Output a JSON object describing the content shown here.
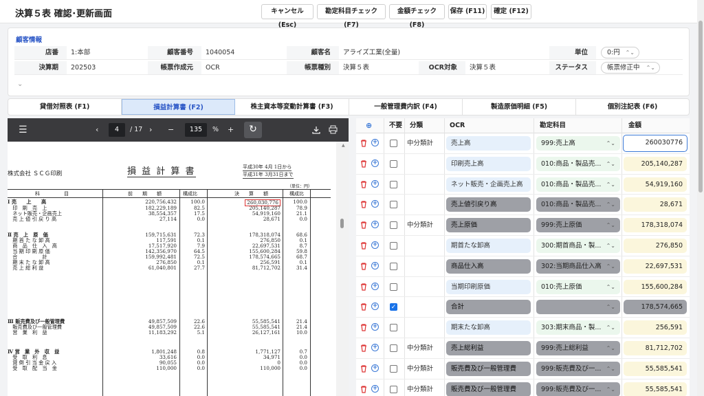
{
  "header": {
    "title": "決算５表 確認･更新画面",
    "buttons": [
      "キャンセル (Esc)",
      "勘定科目チェック (F7)",
      "金額チェック (F8)",
      "保存 (F11)",
      "確定 (F12)"
    ]
  },
  "customer": {
    "title": "顧客情報",
    "labels": {
      "store": "店番",
      "cust_no": "顧客番号",
      "cust_name": "顧客名",
      "unit": "単位",
      "period": "決算期",
      "created_by": "帳票作成元",
      "form_type": "帳票種別",
      "ocr_target": "OCR対象",
      "status": "ステータス"
    },
    "values": {
      "store": "1:本部",
      "cust_no": "1040054",
      "cust_name": "アライズ工業(全量)",
      "unit": "0:円",
      "period": "202503",
      "created_by": "OCR",
      "form_type": "決算５表",
      "ocr_target": "決算５表",
      "status": "帳票修正中"
    }
  },
  "tabs": [
    "貸借対照表 (F1)",
    "損益計算書 (F2)",
    "株主資本等変動計算書 (F3)",
    "一般管理費内訳 (F4)",
    "製造原価明細 (F5)",
    "個別注記表 (F6)"
  ],
  "pdf": {
    "page": "4",
    "total": "/ 17",
    "zoom": "135",
    "percent": "%",
    "doc_title": "損 益 計 算 書",
    "company": "株式会社 ＳＣＧ印刷",
    "prev_period": "平成30年 4月 1日から",
    "prev_period2": "平成31年 3月31日まで",
    "unit_note": "（単位：円）",
    "col_heads": [
      "科　　　　　目",
      "前　　期　　額",
      "構成比",
      "決　　算　　額",
      "構成比"
    ],
    "lines": [
      {
        "item": "Ⅰ 売　　上　　高",
        "prev": "220,756,432",
        "pr": "100.0",
        "cur": "260,030,776",
        "cr": "100.0"
      },
      {
        "item": "　印　刷　売　上",
        "prev": "182,229,189",
        "pr": "82.5",
        "cur": "205,140,287",
        "cr": "78.9"
      },
      {
        "item": "　ネット販売・企画売上",
        "prev": "38,554,357",
        "pr": "17.5",
        "cur": "54,919,160",
        "cr": "21.1"
      },
      {
        "item": "　売 上 値 引 戻 り 高",
        "prev": "27,114",
        "pr": "0.0",
        "cur": "28,671",
        "cr": "0.0"
      },
      {
        "item": "Ⅱ 売　上　原　価",
        "prev": "159,715,631",
        "pr": "72.3",
        "cur": "178,318,074",
        "cr": "68.6"
      },
      {
        "item": "　期 首 た な 卸 高",
        "prev": "117,591",
        "pr": "0.1",
        "cur": "276,850",
        "cr": "0.1"
      },
      {
        "item": "　商　品　仕　入　高",
        "prev": "17,517,920",
        "pr": "7.9",
        "cur": "22,697,531",
        "cr": "8.7"
      },
      {
        "item": "　当 期 印 刷 原 価",
        "prev": "142,356,970",
        "pr": "64.5",
        "cur": "155,600,284",
        "cr": "59.8"
      },
      {
        "item": "　合　　　　　計",
        "prev": "159,992,481",
        "pr": "72.5",
        "cur": "178,574,665",
        "cr": "68.7"
      },
      {
        "item": "　期 末 た な 卸 高",
        "prev": "276,850",
        "pr": "0.1",
        "cur": "256,591",
        "cr": "0.1"
      },
      {
        "item": "　売 上 総 利 益",
        "prev": "61,040,801",
        "pr": "27.7",
        "cur": "81,712,702",
        "cr": "31.4"
      },
      {
        "item": "Ⅲ 販売費及び一般管理費",
        "prev": "49,857,509",
        "pr": "22.6",
        "cur": "55,585,541",
        "cr": "21.4"
      },
      {
        "item": "　販売費及び一般管理費",
        "prev": "49,857,509",
        "pr": "22.6",
        "cur": "55,585,541",
        "cr": "21.4"
      },
      {
        "item": "　営　業　利　益",
        "prev": "11,183,292",
        "pr": "5.1",
        "cur": "26,127,161",
        "cr": "10.0"
      },
      {
        "item": "Ⅳ 営　業　外　収　益",
        "prev": "1,801,248",
        "pr": "0.8",
        "cur": "1,771,127",
        "cr": "0.7"
      },
      {
        "item": "　受　取　利　息",
        "prev": "33,616",
        "pr": "0.0",
        "cur": "34,971",
        "cr": "0.0"
      },
      {
        "item": "　貸 倒 引 当 金 戻 入",
        "prev": "90,055",
        "pr": "0.0",
        "cur": "0",
        "cr": "0.0"
      },
      {
        "item": "　受　取　配　当　金",
        "prev": "110,000",
        "pr": "0.0",
        "cur": "110,000",
        "cr": "0.0"
      }
    ]
  },
  "grid": {
    "headers": [
      "不要",
      "分類",
      "OCR",
      "勘定科目",
      "金額"
    ],
    "rows": [
      {
        "checked": false,
        "cat": "中分類計",
        "ocr": "売上高",
        "ocr_gray": false,
        "acc": "999:売上高",
        "acc_gray": false,
        "amt": "260030776",
        "amt_gray": false,
        "amt_input": true
      },
      {
        "checked": false,
        "cat": "",
        "ocr": "印刷売上高",
        "ocr_gray": false,
        "acc": "010:商品・製品売...",
        "acc_gray": false,
        "amt": "205,140,287",
        "amt_gray": false
      },
      {
        "checked": false,
        "cat": "",
        "ocr": "ネット販売・企画売上高",
        "ocr_gray": false,
        "acc": "010:商品・製品売...",
        "acc_gray": false,
        "amt": "54,919,160",
        "amt_gray": false
      },
      {
        "checked": false,
        "cat": "",
        "ocr": "売上値引戻り高",
        "ocr_gray": true,
        "acc": "010:商品・製品売...",
        "acc_gray": true,
        "amt": "28,671",
        "amt_gray": false
      },
      {
        "checked": false,
        "cat": "中分類計",
        "ocr": "売上原価",
        "ocr_gray": true,
        "acc": "999:売上原価",
        "acc_gray": true,
        "amt": "178,318,074",
        "amt_gray": false
      },
      {
        "checked": false,
        "cat": "",
        "ocr": "期首たな卸高",
        "ocr_gray": false,
        "acc": "300:期首商品・製...",
        "acc_gray": false,
        "amt": "276,850",
        "amt_gray": false
      },
      {
        "checked": false,
        "cat": "",
        "ocr": "商品仕入高",
        "ocr_gray": true,
        "acc": "302:当期商品仕入高",
        "acc_gray": true,
        "amt": "22,697,531",
        "amt_gray": false
      },
      {
        "checked": false,
        "cat": "",
        "ocr": "当期印刷原価",
        "ocr_gray": false,
        "acc": "010:売上原価",
        "acc_gray": false,
        "amt": "155,600,284",
        "amt_gray": false
      },
      {
        "checked": true,
        "cat": "",
        "ocr": "合計",
        "ocr_gray": true,
        "acc": "",
        "acc_gray": true,
        "amt": "178,574,665",
        "amt_gray": true
      },
      {
        "checked": false,
        "cat": "",
        "ocr": "期末たな卸高",
        "ocr_gray": false,
        "acc": "303:期末商品・製...",
        "acc_gray": false,
        "amt": "256,591",
        "amt_gray": false
      },
      {
        "checked": false,
        "cat": "中分類計",
        "ocr": "売上総利益",
        "ocr_gray": true,
        "acc": "999:売上総利益",
        "acc_gray": true,
        "amt": "81,712,702",
        "amt_gray": false
      },
      {
        "checked": false,
        "cat": "中分類計",
        "ocr": "販売費及び一般管理費",
        "ocr_gray": true,
        "acc": "999:販売費及び一...",
        "acc_gray": true,
        "amt": "55,585,541",
        "amt_gray": false
      },
      {
        "checked": false,
        "cat": "中分類計",
        "ocr": "販売費及び一般管理費",
        "ocr_gray": true,
        "acc": "999:販売費及び一...",
        "acc_gray": true,
        "amt": "55,585,541",
        "amt_gray": false
      }
    ]
  }
}
